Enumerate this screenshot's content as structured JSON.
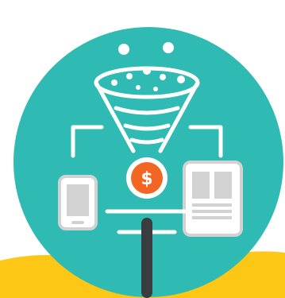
{
  "illustration": {
    "icons": [
      "funnel-icon",
      "dollar-coin-icon",
      "phone-icon",
      "tablet-icon",
      "connector-lines-icon"
    ],
    "coin_symbol": "$"
  },
  "colors": {
    "background": "#ffffff",
    "teal_circle": "#2fbab3",
    "yellow_accent": "#fcc815",
    "white_lines": "#ffffff",
    "gray_device": "#d2d2d2",
    "coin_orange": "#f26522",
    "pole_dark": "#3a3d3f"
  }
}
